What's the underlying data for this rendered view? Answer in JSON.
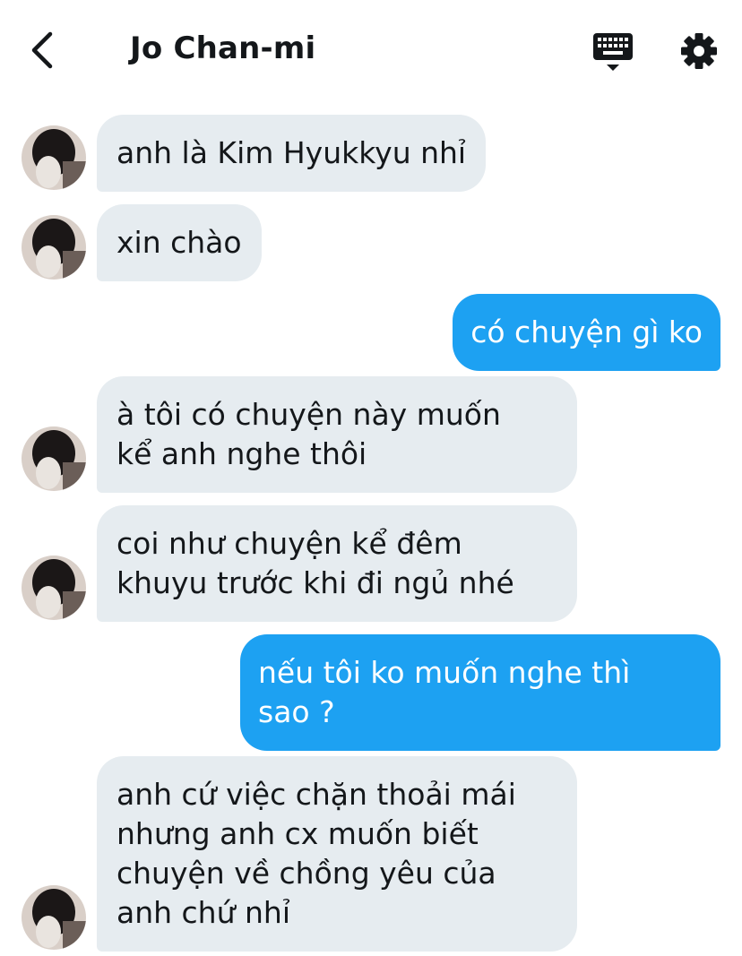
{
  "header": {
    "back_icon": "chevron-left-icon",
    "title": "Jo Chan-mi",
    "keyboard_icon": "keyboard-icon",
    "settings_icon": "gear-icon"
  },
  "colors": {
    "incoming_bubble": "#e6ecf0",
    "outgoing_bubble": "#1da1f2",
    "text": "#14171a"
  },
  "messages": [
    {
      "direction": "incoming",
      "text": "anh là Kim Hyukkyu nhỉ",
      "avatar": "contact-avatar"
    },
    {
      "direction": "incoming",
      "text": "xin chào",
      "avatar": "contact-avatar"
    },
    {
      "direction": "outgoing",
      "text": "có chuyện gì ko"
    },
    {
      "direction": "incoming",
      "text": "à tôi có chuyện này muốn\nkể anh nghe thôi",
      "avatar": "contact-avatar"
    },
    {
      "direction": "incoming",
      "text": "coi như chuyện kể đêm\nkhuyu trước khi đi ngủ nhé",
      "avatar": "contact-avatar"
    },
    {
      "direction": "outgoing",
      "text": "nếu tôi ko muốn nghe thì\nsao ?"
    },
    {
      "direction": "incoming",
      "text": "anh cứ việc chặn thoải mái\nnhưng anh cx muốn biết\nchuyện về chồng yêu của\nanh chứ nhỉ",
      "avatar": "contact-avatar"
    }
  ]
}
